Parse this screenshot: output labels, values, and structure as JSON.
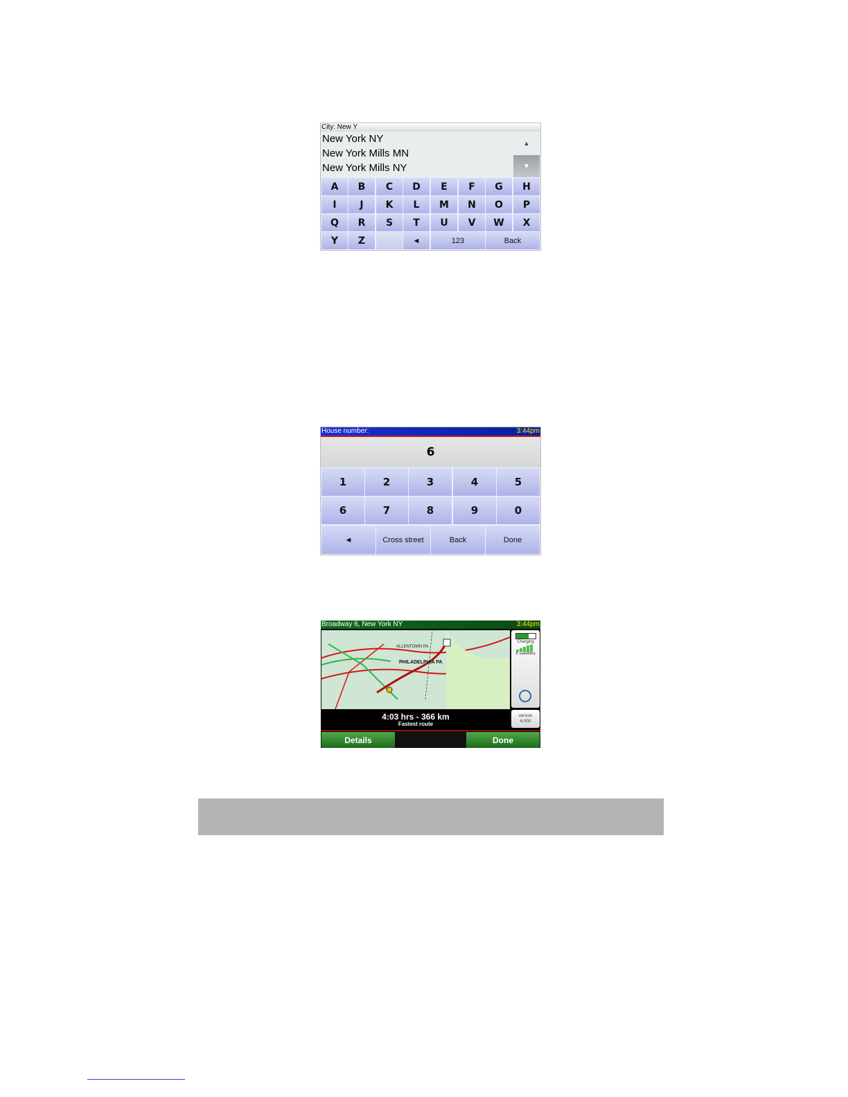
{
  "city_screen": {
    "title": "City: New Y",
    "results": [
      "New York NY",
      "New York Mills MN",
      "New York Mills NY"
    ],
    "keys_rows": [
      [
        "A",
        "B",
        "C",
        "D",
        "E",
        "F",
        "G",
        "H"
      ],
      [
        "I",
        "J",
        "K",
        "L",
        "M",
        "N",
        "O",
        "P"
      ],
      [
        "Q",
        "R",
        "S",
        "T",
        "U",
        "V",
        "W",
        "X"
      ]
    ],
    "last_row": {
      "y": "Y",
      "z": "Z",
      "backspace": "◄",
      "numbers": "123",
      "back": "Back"
    },
    "scroll_up": "▲",
    "scroll_down": "▼"
  },
  "house_screen": {
    "title": "House number:",
    "time": "3:44pm",
    "value": "6",
    "digits_row1": [
      "1",
      "2",
      "3",
      "4",
      "5"
    ],
    "digits_row2": [
      "6",
      "7",
      "8",
      "9",
      "0"
    ],
    "buttons": {
      "backspace": "◄",
      "cross_street": "Cross street",
      "back": "Back",
      "done": "Done"
    }
  },
  "route_screen": {
    "title": "Broadway 6, New York NY",
    "time": "3:44pm",
    "map_labels": {
      "allentown": "ALLENTOWN PA",
      "philadelphia": "PHILADELPHIA PA"
    },
    "status": {
      "charging": "Charging",
      "satellites": "8 satellites"
    },
    "version": {
      "label": "version",
      "number": "6.000"
    },
    "summary": "4:03 hrs - 366 km",
    "route_type": "Fastest route",
    "buttons": {
      "details": "Details",
      "done": "Done"
    },
    "colors": {
      "title_green": "#0f6a1f",
      "button_green": "#2f8a2a",
      "route_red": "#d01818"
    }
  }
}
